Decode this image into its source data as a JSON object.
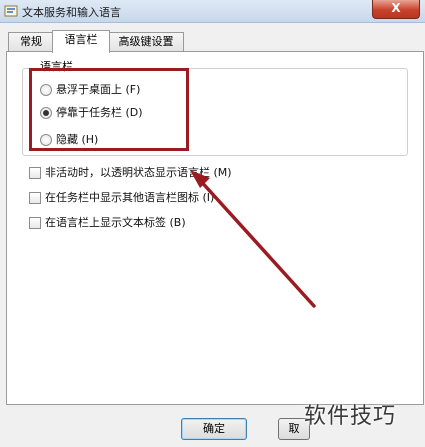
{
  "window": {
    "title": "文本服务和输入语言",
    "close_glyph": "X"
  },
  "tabs": [
    {
      "label": "常规",
      "active": false
    },
    {
      "label": "语言栏",
      "active": true
    },
    {
      "label": "高级键设置",
      "active": false
    }
  ],
  "language_bar_group": {
    "legend": "语言栏",
    "options": [
      {
        "label": "悬浮于桌面上 (F)",
        "checked": false
      },
      {
        "label": "停靠于任务栏 (D)",
        "checked": true
      },
      {
        "label": "隐藏 (H)",
        "checked": false
      }
    ]
  },
  "checkboxes": [
    {
      "label": "非活动时，以透明状态显示语言栏 (M)",
      "checked": false
    },
    {
      "label": "在任务栏中显示其他语言栏图标 (I)",
      "checked": false
    },
    {
      "label": "在语言栏上显示文本标签 (B)",
      "checked": false
    }
  ],
  "buttons": {
    "ok": "确定",
    "cancel": "取"
  },
  "annotation_color": "#9b1b22",
  "watermark": "软件技巧"
}
